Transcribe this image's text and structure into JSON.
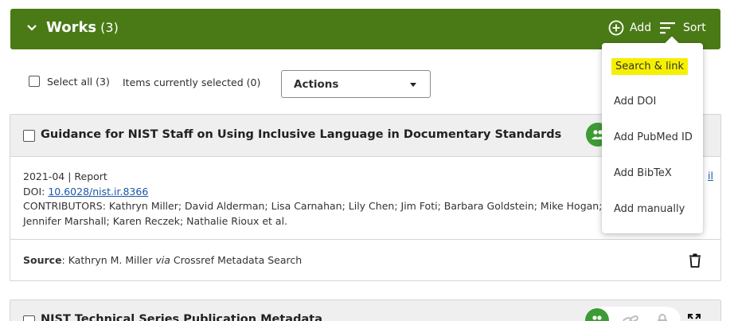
{
  "colors": {
    "header_bg": "#4a7a16",
    "accent_green": "#3d9b35",
    "highlight": "#f6f000",
    "link": "#1a56a8"
  },
  "header": {
    "title": "Works",
    "count": "(3)",
    "add_label": "Add",
    "sort_label": "Sort",
    "icons": [
      "chevron-down-icon",
      "plus-circle-icon",
      "sort-icon"
    ]
  },
  "toolbar": {
    "select_all_label": "Select all (3)",
    "items_selected": "Items currently selected (0)",
    "actions_label": "Actions"
  },
  "add_menu": {
    "items": [
      "Search & link",
      "Add DOI",
      "Add PubMed ID",
      "Add BibTeX",
      "Add manually"
    ],
    "highlighted": "Search & link"
  },
  "works": [
    {
      "title": "Guidance for NIST Staff on Using Inclusive Language in Documentary Standards",
      "date_type": "2021-04 | Report",
      "doi_label": "DOI: ",
      "doi": "10.6028/nist.ir.8366",
      "contributors_line1": "CONTRIBUTORS: Kathryn Miller; David Alderman; Lisa Carnahan; Lily Chen; Jim Foti; Barbara Goldstein; Mike Hogan;",
      "contributors_line2": "Jennifer Marshall; Karen Reczek; Nathalie Rioux et al.",
      "edge_link": "il",
      "source_label": "Source",
      "source_author": ": Kathryn M. Miller ",
      "source_via": "via",
      "source_service": " Crossref Metadata Search"
    },
    {
      "title": "NIST Technical Series Publication Metadata"
    }
  ]
}
